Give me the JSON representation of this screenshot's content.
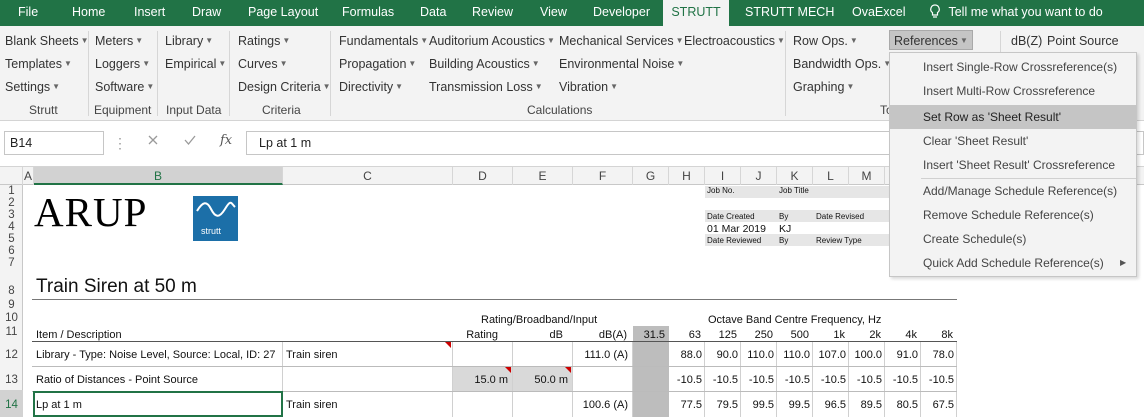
{
  "tabs": [
    "File",
    "Home",
    "Insert",
    "Draw",
    "Page Layout",
    "Formulas",
    "Data",
    "Review",
    "View",
    "Developer",
    "STRUTT",
    "STRUTT MECH",
    "OvaExcel"
  ],
  "tell_me": "Tell me what you want to do",
  "ribbon": {
    "strutt": [
      "Blank Sheets",
      "Templates",
      "Settings"
    ],
    "equipment": [
      "Meters",
      "Loggers",
      "Software"
    ],
    "input": [
      "Library",
      "Empirical"
    ],
    "criteria": [
      "Ratings",
      "Curves",
      "Design Criteria"
    ],
    "calc1": [
      "Fundamentals",
      "Propagation",
      "Directivity"
    ],
    "calc2": [
      "Auditorium Acoustics",
      "Building Acoustics",
      "Transmission Loss"
    ],
    "calc3": [
      "Mechanical Services",
      "Environmental Noise",
      "Vibration"
    ],
    "calc4": [
      "Electroacoustics"
    ],
    "tools": [
      "Row Ops.",
      "Bandwidth Ops.",
      "Graphing"
    ],
    "references": "References",
    "dbz": "dB(Z)",
    "point_source": "Point Source",
    "groups": {
      "strutt": "Strutt",
      "equipment": "Equipment",
      "input": "Input Data",
      "criteria": "Criteria",
      "calc": "Calculations",
      "tools": "To"
    }
  },
  "formula_bar": {
    "name_box": "B14",
    "fx": "fx",
    "value": "Lp at 1 m"
  },
  "columns": [
    "A",
    "B",
    "C",
    "D",
    "E",
    "F",
    "G",
    "H",
    "I",
    "J",
    "K",
    "L",
    "M"
  ],
  "rows": [
    "1",
    "2",
    "3",
    "4",
    "5",
    "6",
    "7",
    "8",
    "9",
    "10",
    "11",
    "12",
    "13",
    "14"
  ],
  "sheet": {
    "logo_text": "ARUP",
    "logo_sub": "strutt",
    "job_no": "Job No.",
    "job_title": "Job Title",
    "date_created_label": "Date Created",
    "by_label": "By",
    "date_revised_label": "Date Revised",
    "date_created": "01 Mar 2019",
    "by": "KJ",
    "date_reviewed_label": "Date Reviewed",
    "by2_label": "By",
    "review_type_label": "Review Type",
    "title": "Train Siren at 50 m",
    "group_rating": "Rating/Broadband/Input",
    "group_octave": "Octave Band Centre Frequency, Hz",
    "hdr_item": "Item / Description",
    "hdr_rating": "Rating",
    "hdr_db": "dB",
    "hdr_dba": "dB(A)",
    "freqs": [
      "31.5",
      "63",
      "125",
      "250",
      "500",
      "1k",
      "2k",
      "4k",
      "8k"
    ],
    "r12": {
      "desc": "Library - Type: Noise Level, Source: Local, ID: 27",
      "c": "Train siren",
      "dba": "111.0 (A)",
      "vals": [
        "",
        "88.0",
        "90.0",
        "110.0",
        "110.0",
        "107.0",
        "100.0",
        "91.0",
        "78.0"
      ]
    },
    "r13": {
      "desc": "Ratio of Distances -  Point Source",
      "d": "15.0 m",
      "e": "50.0 m",
      "vals": [
        "",
        "-10.5",
        "-10.5",
        "-10.5",
        "-10.5",
        "-10.5",
        "-10.5",
        "-10.5",
        "-10.5"
      ]
    },
    "r14": {
      "desc": "Lp at 1 m",
      "c": "Train siren",
      "dba": "100.6 (A)",
      "vals": [
        "",
        "77.5",
        "79.5",
        "99.5",
        "99.5",
        "96.5",
        "89.5",
        "80.5",
        "67.5"
      ]
    }
  },
  "menu": [
    {
      "label": "Insert Single-Row Crossreference(s)"
    },
    {
      "label": "Insert Multi-Row Crossreference"
    },
    {
      "label": "Set Row as 'Sheet Result'"
    },
    {
      "label": "Clear 'Sheet Result'"
    },
    {
      "label": "Insert 'Sheet Result' Crossreference"
    },
    {
      "label": "Add/Manage Schedule Reference(s)"
    },
    {
      "label": "Remove Schedule Reference(s)"
    },
    {
      "label": "Create Schedule(s)"
    },
    {
      "label": "Quick Add Schedule Reference(s)"
    }
  ],
  "colors": {
    "excel_green": "#217346",
    "strutt_blue": "#1c6fa8",
    "note_red": "#c00000"
  },
  "icons": [
    "lightbulb-icon",
    "cancel-icon",
    "enter-icon",
    "fx-icon",
    "submenu-arrow-icon",
    "dropdown-arrow-icon"
  ]
}
